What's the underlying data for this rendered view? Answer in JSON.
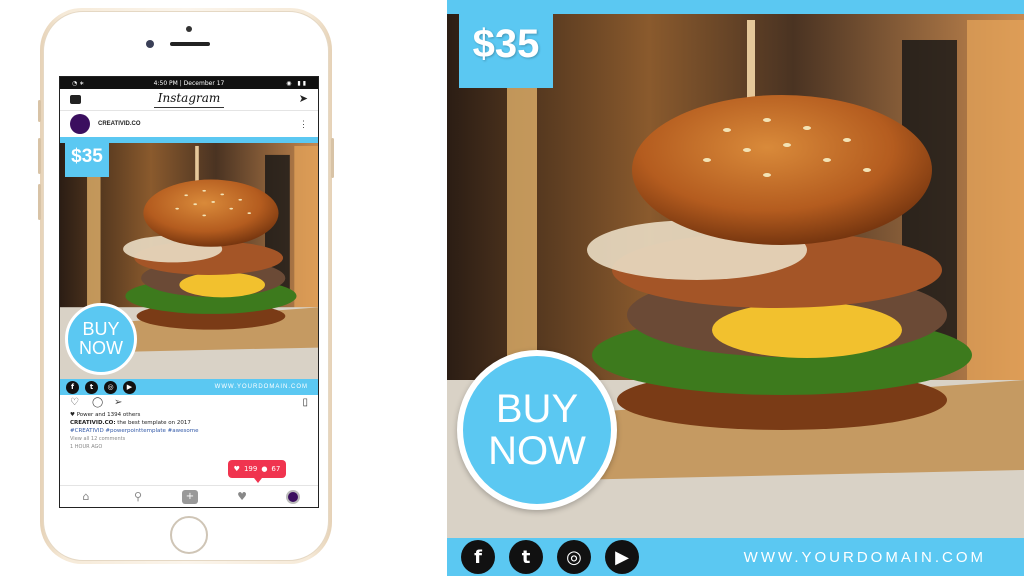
{
  "price": "$35",
  "buy_line1": "BUY",
  "buy_line2": "NOW",
  "domain": "WWW.YOURDOMAIN.COM",
  "social_icons": [
    "facebook-icon",
    "twitter-icon",
    "instagram-icon",
    "youtube-icon"
  ],
  "social_glyphs": [
    "f",
    "t",
    "◎",
    "▶"
  ],
  "colors": {
    "accent": "#5bc8f2",
    "notif": "#f0344f",
    "avatar": "#3b0f5f"
  },
  "phone": {
    "status_time": "4:50 PM | December 17",
    "app_name": "Instagram",
    "username": "CREATIVID.CO",
    "likes_line": "Power and 1394 others",
    "caption_user": "CREATIVID.CO:",
    "caption_text": " the best template on 2017",
    "hashtags": "#CREATIVID #powerpointtemplate #awesome",
    "comments_link": "View all 12 comments",
    "time_ago": "1 HOUR AGO",
    "notif_likes": "199",
    "notif_follows": "67"
  }
}
